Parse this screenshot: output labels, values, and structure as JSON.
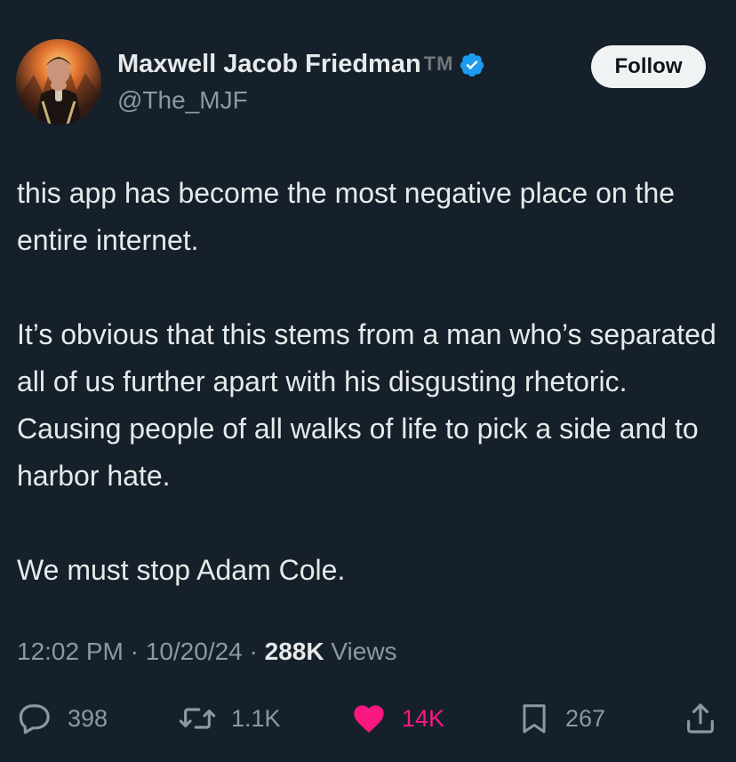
{
  "author": {
    "display_name": "Maxwell Jacob Friedman",
    "name_suffix": "TM",
    "handle": "@The_MJF",
    "verified": true,
    "avatar_icon": "profile-photo"
  },
  "follow_label": "Follow",
  "tweet": {
    "paragraphs": [
      "this app has become the most negative place on the entire internet.",
      "It’s obvious that this stems from a man who’s separated all of us further apart with his disgusting rhetoric. Causing people of all walks of life to pick a side and to harbor hate.",
      "We must stop Adam Cole."
    ]
  },
  "meta": {
    "time": "12:02 PM",
    "sep1": "·",
    "date": "10/20/24",
    "sep2": "·",
    "views_count": "288K",
    "views_label": "Views"
  },
  "actions": {
    "replies": "398",
    "reposts": "1.1K",
    "likes": "14K",
    "bookmarks": "267"
  },
  "icons": {
    "reply": "reply-icon",
    "repost": "repost-icon",
    "like": "heart-icon",
    "bookmark": "bookmark-icon",
    "share": "share-icon",
    "verified": "verified-badge-icon"
  },
  "colors": {
    "background": "#15202b",
    "like_active": "#f91880",
    "verified": "#1d9bf0",
    "muted": "#8b98a5"
  }
}
